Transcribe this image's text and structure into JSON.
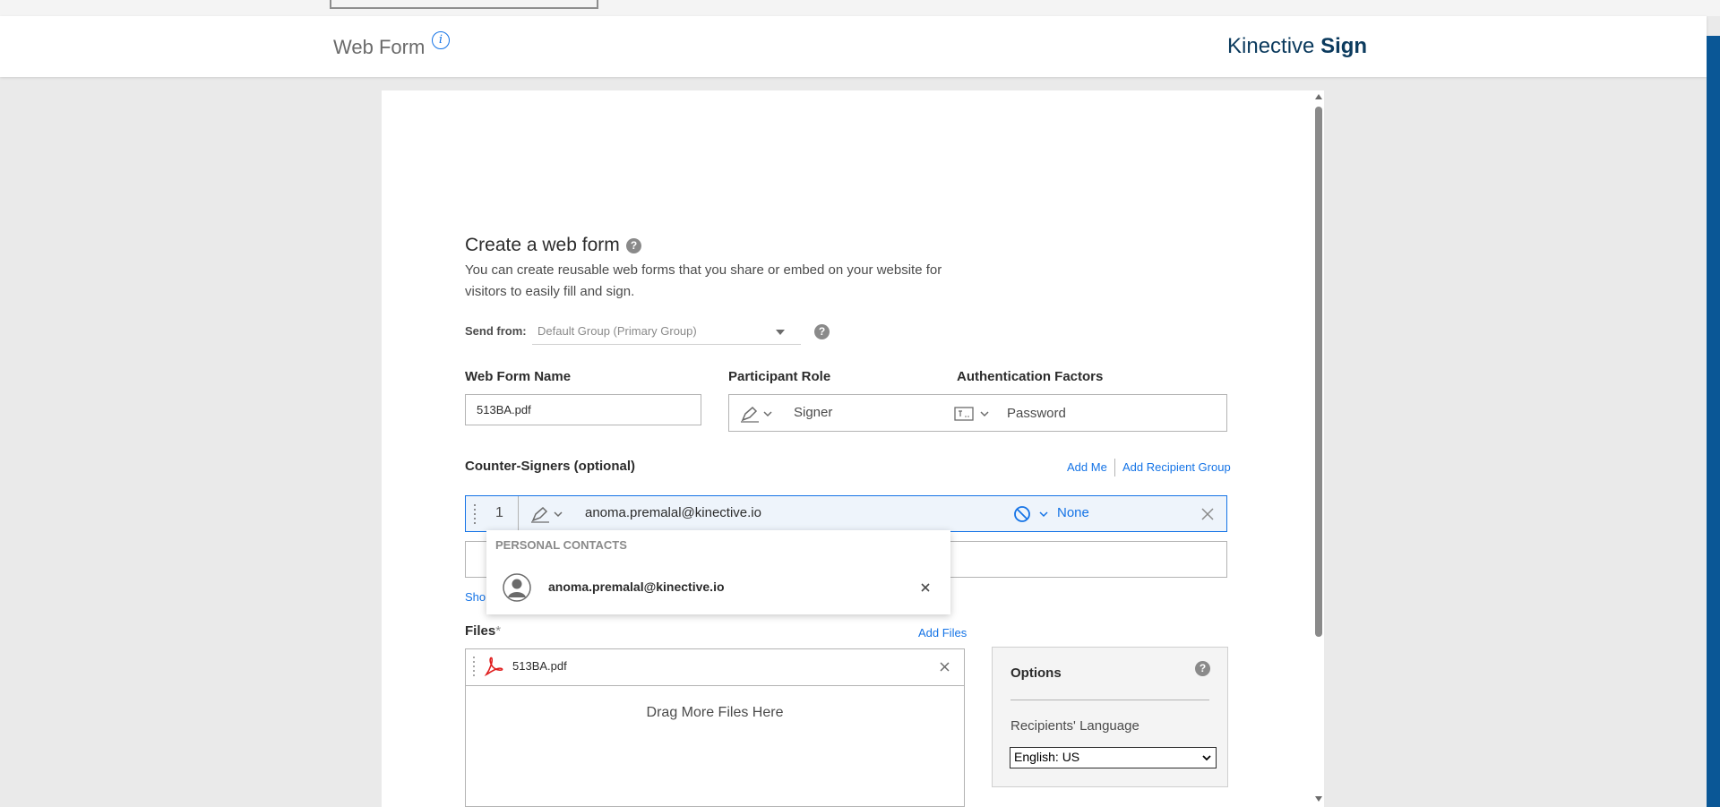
{
  "header": {
    "title": "Web Form",
    "info_icon": "info-icon",
    "brand_regular": "Kinective ",
    "brand_bold": "Sign"
  },
  "form": {
    "heading": "Create a web form",
    "description": "You can create reusable web forms that you share or embed on your website for visitors to easily fill and sign.",
    "send_from_label": "Send from:",
    "send_from_value": "Default Group (Primary Group)",
    "web_form_name_label": "Web Form Name",
    "web_form_name_value": "513BA.pdf",
    "participant_role_label": "Participant Role",
    "participant_role_value": "Signer",
    "auth_factors_label": "Authentication Factors",
    "auth_factors_value": "Password",
    "counter_signers_label": "Counter-Signers (optional)",
    "add_me": "Add Me",
    "add_recipient_group": "Add Recipient Group",
    "signer_index": "1",
    "signer_email": "anoma.premalal@kinective.io",
    "signer_auth": "None",
    "show_link_fragment": "Sho",
    "files_label": "Files",
    "files_required": "*",
    "add_files": "Add Files",
    "file_name": "513BA.pdf",
    "drag_text": "Drag More Files Here"
  },
  "dropdown": {
    "section_title": "PERSONAL CONTACTS",
    "contact_email": "anoma.premalal@kinective.io"
  },
  "options": {
    "title": "Options",
    "language_label": "Recipients' Language",
    "language_value": "English: US"
  },
  "colors": {
    "accent": "#1473e6",
    "brand": "#0c3b5e",
    "scrollbar": "#0a5796"
  }
}
